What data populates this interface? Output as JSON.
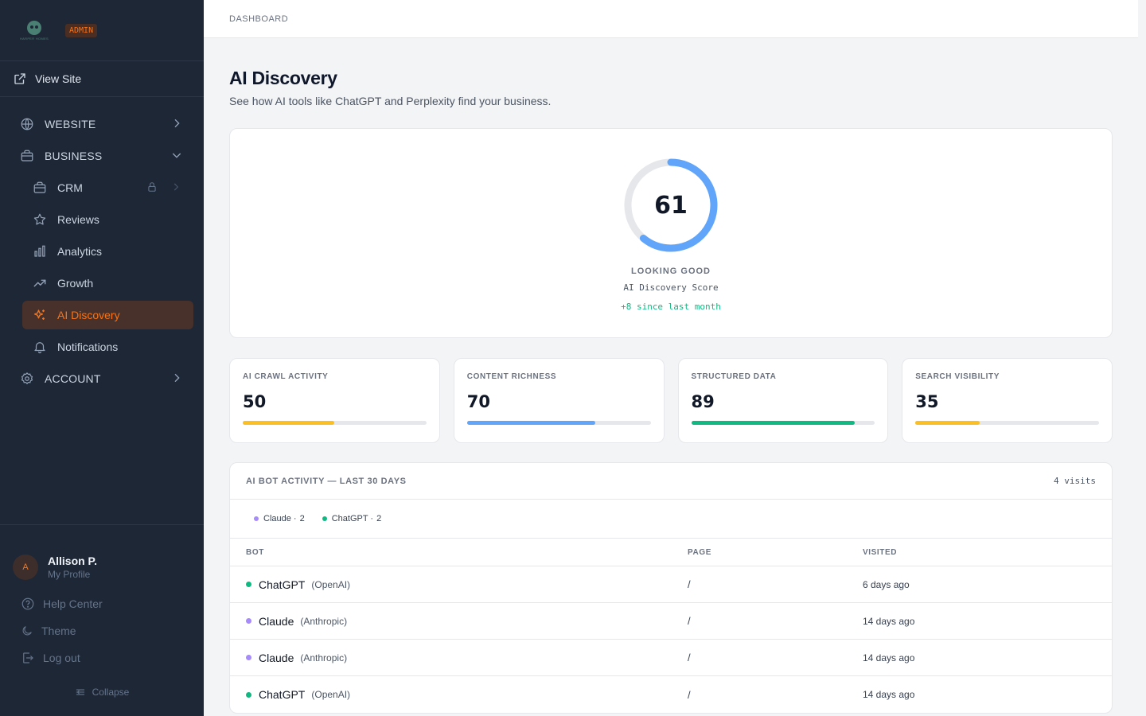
{
  "brand": {
    "logo_text": "HARPER HOMES",
    "badge": "ADMIN"
  },
  "sidebar": {
    "view_site": "View Site",
    "items": [
      {
        "label": "WEBSITE",
        "icon": "globe-icon"
      },
      {
        "label": "BUSINESS",
        "icon": "briefcase-icon"
      },
      {
        "label": "CRM",
        "icon": "briefcase-icon"
      },
      {
        "label": "Reviews",
        "icon": "star-icon"
      },
      {
        "label": "Analytics",
        "icon": "bar-chart-icon"
      },
      {
        "label": "Growth",
        "icon": "trending-up-icon"
      },
      {
        "label": "AI Discovery",
        "icon": "sparkles-icon",
        "active": true
      },
      {
        "label": "Notifications",
        "icon": "bell-icon"
      },
      {
        "label": "ACCOUNT",
        "icon": "gear-icon"
      }
    ],
    "user": {
      "initial": "A",
      "name": "Allison P.",
      "subtitle": "My Profile"
    },
    "help": "Help Center",
    "theme": "Theme",
    "logout": "Log out",
    "collapse": "Collapse"
  },
  "header": {
    "breadcrumb": "DASHBOARD"
  },
  "page": {
    "title": "AI Discovery",
    "subtitle": "See how AI tools like ChatGPT and Perplexity find your business."
  },
  "score": {
    "value": "61",
    "fraction": 0.61,
    "status": "LOOKING GOOD",
    "label": "AI Discovery Score",
    "delta": "+8 since last month",
    "color": "#60a5fa"
  },
  "metrics": [
    {
      "label": "AI CRAWL ACTIVITY",
      "value": "50",
      "percent": 50,
      "color": "#fbbf24"
    },
    {
      "label": "CONTENT RICHNESS",
      "value": "70",
      "percent": 70,
      "color": "#60a5fa"
    },
    {
      "label": "STRUCTURED DATA",
      "value": "89",
      "percent": 89,
      "color": "#10b981"
    },
    {
      "label": "SEARCH VISIBILITY",
      "value": "35",
      "percent": 35,
      "color": "#fbbf24"
    }
  ],
  "activity": {
    "title": "AI BOT ACTIVITY — LAST 30 DAYS",
    "count": "4 visits",
    "legend": [
      {
        "name": "Claude ·",
        "count": "2",
        "color": "#a78bfa"
      },
      {
        "name": "ChatGPT ·",
        "count": "2",
        "color": "#10b981"
      }
    ],
    "columns": {
      "bot": "BOT",
      "page": "PAGE",
      "visited": "VISITED"
    },
    "rows": [
      {
        "bot": "ChatGPT",
        "vendor": "(OpenAI)",
        "page": "/",
        "visited": "6 days ago",
        "color": "#10b981"
      },
      {
        "bot": "Claude",
        "vendor": "(Anthropic)",
        "page": "/",
        "visited": "14 days ago",
        "color": "#a78bfa"
      },
      {
        "bot": "Claude",
        "vendor": "(Anthropic)",
        "page": "/",
        "visited": "14 days ago",
        "color": "#a78bfa"
      },
      {
        "bot": "ChatGPT",
        "vendor": "(OpenAI)",
        "page": "/",
        "visited": "14 days ago",
        "color": "#10b981"
      }
    ]
  }
}
